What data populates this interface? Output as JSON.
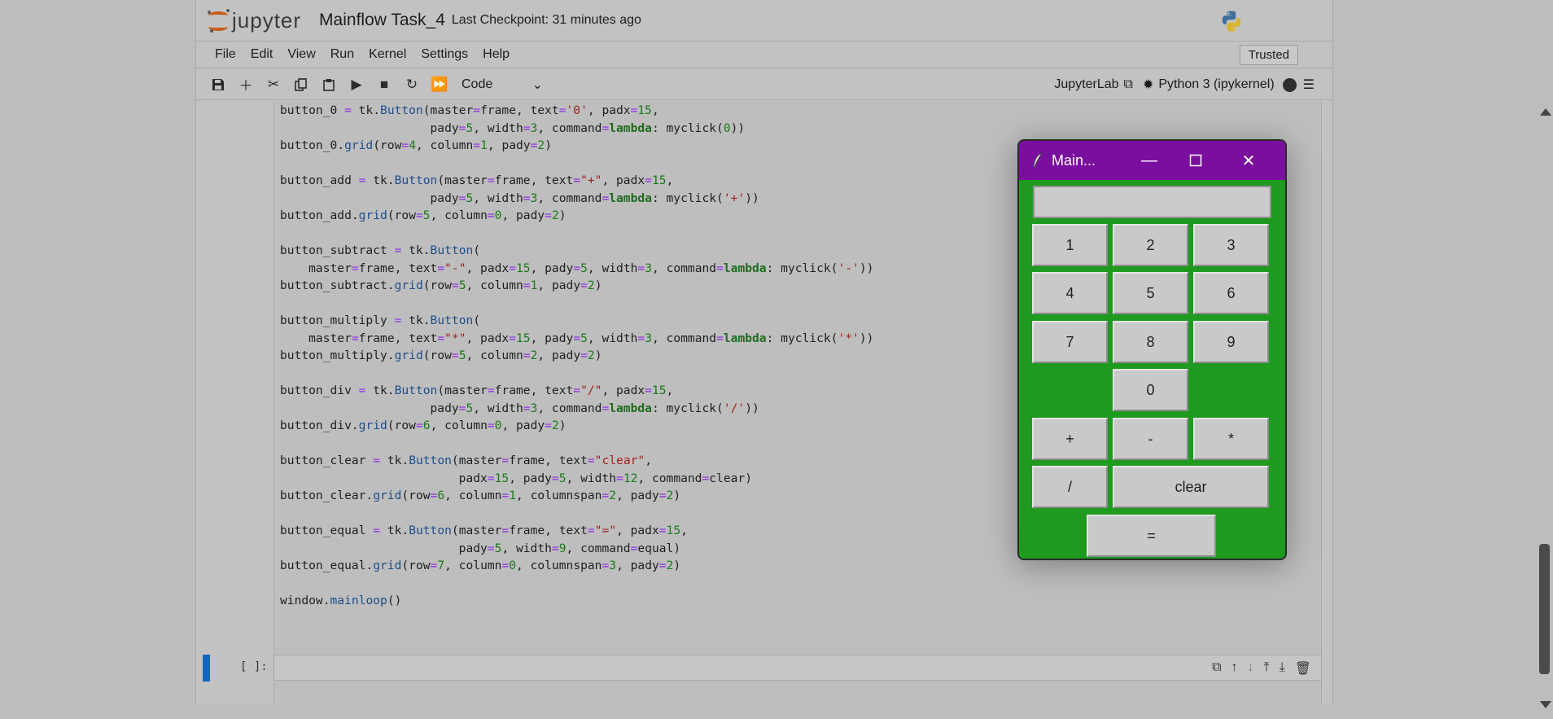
{
  "header": {
    "logo_text": "jupyter",
    "notebook_title": "Mainflow Task_4",
    "checkpoint": "Last Checkpoint: 31 minutes ago"
  },
  "menubar": {
    "items": [
      "File",
      "Edit",
      "View",
      "Run",
      "Kernel",
      "Settings",
      "Help"
    ],
    "trusted": "Trusted"
  },
  "toolbar": {
    "icons": [
      "save-icon",
      "add-icon",
      "cut-icon",
      "copy-icon",
      "paste-icon",
      "run-icon",
      "stop-icon",
      "restart-icon",
      "fast-forward-icon"
    ],
    "cell_type": "Code",
    "jupyterlab": "JupyterLab",
    "kernel": "Python 3 (ipykernel)"
  },
  "code_lines": [
    "button_0 = tk.Button(master=frame, text='0', padx=15,",
    "                     pady=5, width=3, command=lambda: myclick(0))",
    "button_0.grid(row=4, column=1, pady=2)",
    "",
    "button_add = tk.Button(master=frame, text=\"+\", padx=15,",
    "                     pady=5, width=3, command=lambda: myclick('+'))",
    "button_add.grid(row=5, column=0, pady=2)",
    "",
    "button_subtract = tk.Button(",
    "    master=frame, text=\"-\", padx=15, pady=5, width=3, command=lambda: myclick('-'))",
    "button_subtract.grid(row=5, column=1, pady=2)",
    "",
    "button_multiply = tk.Button(",
    "    master=frame, text=\"*\", padx=15, pady=5, width=3, command=lambda: myclick('*'))",
    "button_multiply.grid(row=5, column=2, pady=2)",
    "",
    "button_div = tk.Button(master=frame, text=\"/\", padx=15,",
    "                     pady=5, width=3, command=lambda: myclick('/'))",
    "button_div.grid(row=6, column=0, pady=2)",
    "",
    "button_clear = tk.Button(master=frame, text=\"clear\",",
    "                         padx=15, pady=5, width=12, command=clear)",
    "button_clear.grid(row=6, column=1, columnspan=2, pady=2)",
    "",
    "button_equal = tk.Button(master=frame, text=\"=\", padx=15,",
    "                         pady=5, width=9, command=equal)",
    "button_equal.grid(row=7, column=0, columnspan=3, pady=2)",
    "",
    "window.mainloop()"
  ],
  "empty_cell": {
    "prompt": "[ ]:"
  },
  "calculator": {
    "title": "Main...",
    "display_value": "",
    "buttons": [
      "1",
      "2",
      "3",
      "4",
      "5",
      "6",
      "7",
      "8",
      "9",
      "0",
      "+",
      "-",
      "*",
      "/",
      "clear",
      "="
    ]
  },
  "colors": {
    "calc_titlebar": "#7a0f9f",
    "calc_background": "#1e9a1e",
    "active_cell_bar": "#1565c0",
    "logo_orange": "#c75e19"
  }
}
